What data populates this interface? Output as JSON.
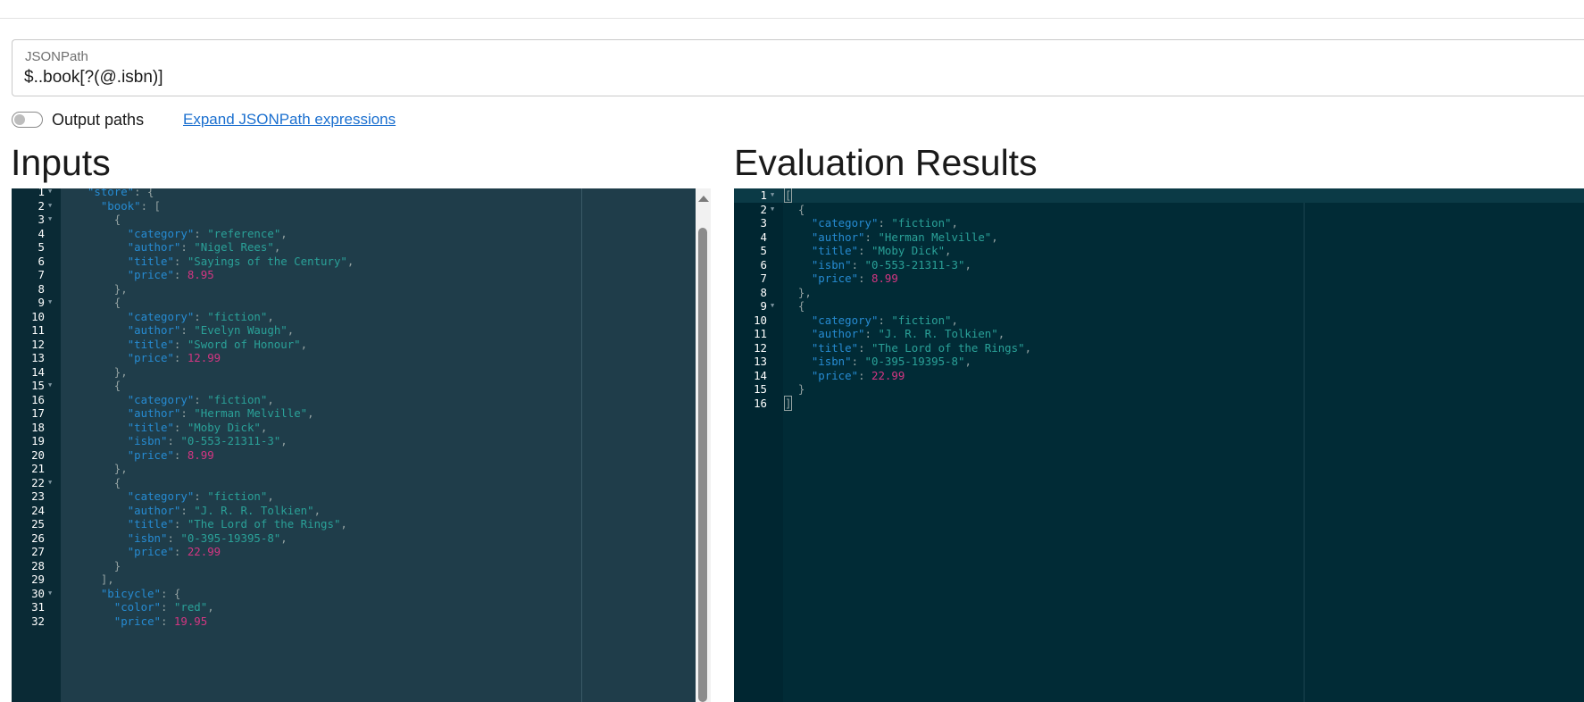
{
  "query": {
    "label": "JSONPath",
    "value": "$..book[?(@.isbn)]"
  },
  "options": {
    "output_paths_label": "Output paths",
    "output_paths_on": false,
    "expand_link": "Expand JSONPath expressions"
  },
  "inputs_heading": "Inputs",
  "results_heading": "Evaluation Results",
  "input_editor": {
    "lines": [
      {
        "n": "1",
        "fold": true,
        "tokens": [
          [
            "p",
            "  "
          ],
          [
            "k",
            "\"store\""
          ],
          [
            "p",
            ": {"
          ]
        ]
      },
      {
        "n": "2",
        "fold": true,
        "tokens": [
          [
            "p",
            "    "
          ],
          [
            "k",
            "\"book\""
          ],
          [
            "p",
            ": ["
          ]
        ]
      },
      {
        "n": "3",
        "fold": true,
        "tokens": [
          [
            "p",
            "      {"
          ]
        ]
      },
      {
        "n": "4",
        "tokens": [
          [
            "p",
            "        "
          ],
          [
            "k",
            "\"category\""
          ],
          [
            "p",
            ": "
          ],
          [
            "s",
            "\"reference\""
          ],
          [
            "p",
            ","
          ]
        ]
      },
      {
        "n": "5",
        "tokens": [
          [
            "p",
            "        "
          ],
          [
            "k",
            "\"author\""
          ],
          [
            "p",
            ": "
          ],
          [
            "s",
            "\"Nigel Rees\""
          ],
          [
            "p",
            ","
          ]
        ]
      },
      {
        "n": "6",
        "tokens": [
          [
            "p",
            "        "
          ],
          [
            "k",
            "\"title\""
          ],
          [
            "p",
            ": "
          ],
          [
            "s",
            "\"Sayings of the Century\""
          ],
          [
            "p",
            ","
          ]
        ]
      },
      {
        "n": "7",
        "tokens": [
          [
            "p",
            "        "
          ],
          [
            "k",
            "\"price\""
          ],
          [
            "p",
            ": "
          ],
          [
            "n",
            "8.95"
          ]
        ]
      },
      {
        "n": "8",
        "tokens": [
          [
            "p",
            "      },"
          ]
        ]
      },
      {
        "n": "9",
        "fold": true,
        "tokens": [
          [
            "p",
            "      {"
          ]
        ]
      },
      {
        "n": "10",
        "tokens": [
          [
            "p",
            "        "
          ],
          [
            "k",
            "\"category\""
          ],
          [
            "p",
            ": "
          ],
          [
            "s",
            "\"fiction\""
          ],
          [
            "p",
            ","
          ]
        ]
      },
      {
        "n": "11",
        "tokens": [
          [
            "p",
            "        "
          ],
          [
            "k",
            "\"author\""
          ],
          [
            "p",
            ": "
          ],
          [
            "s",
            "\"Evelyn Waugh\""
          ],
          [
            "p",
            ","
          ]
        ]
      },
      {
        "n": "12",
        "tokens": [
          [
            "p",
            "        "
          ],
          [
            "k",
            "\"title\""
          ],
          [
            "p",
            ": "
          ],
          [
            "s",
            "\"Sword of Honour\""
          ],
          [
            "p",
            ","
          ]
        ]
      },
      {
        "n": "13",
        "tokens": [
          [
            "p",
            "        "
          ],
          [
            "k",
            "\"price\""
          ],
          [
            "p",
            ": "
          ],
          [
            "n",
            "12.99"
          ]
        ]
      },
      {
        "n": "14",
        "tokens": [
          [
            "p",
            "      },"
          ]
        ]
      },
      {
        "n": "15",
        "fold": true,
        "tokens": [
          [
            "p",
            "      {"
          ]
        ]
      },
      {
        "n": "16",
        "tokens": [
          [
            "p",
            "        "
          ],
          [
            "k",
            "\"category\""
          ],
          [
            "p",
            ": "
          ],
          [
            "s",
            "\"fiction\""
          ],
          [
            "p",
            ","
          ]
        ]
      },
      {
        "n": "17",
        "tokens": [
          [
            "p",
            "        "
          ],
          [
            "k",
            "\"author\""
          ],
          [
            "p",
            ": "
          ],
          [
            "s",
            "\"Herman Melville\""
          ],
          [
            "p",
            ","
          ]
        ]
      },
      {
        "n": "18",
        "tokens": [
          [
            "p",
            "        "
          ],
          [
            "k",
            "\"title\""
          ],
          [
            "p",
            ": "
          ],
          [
            "s",
            "\"Moby Dick\""
          ],
          [
            "p",
            ","
          ]
        ]
      },
      {
        "n": "19",
        "tokens": [
          [
            "p",
            "        "
          ],
          [
            "k",
            "\"isbn\""
          ],
          [
            "p",
            ": "
          ],
          [
            "s",
            "\"0-553-21311-3\""
          ],
          [
            "p",
            ","
          ]
        ]
      },
      {
        "n": "20",
        "tokens": [
          [
            "p",
            "        "
          ],
          [
            "k",
            "\"price\""
          ],
          [
            "p",
            ": "
          ],
          [
            "n",
            "8.99"
          ]
        ]
      },
      {
        "n": "21",
        "tokens": [
          [
            "p",
            "      },"
          ]
        ]
      },
      {
        "n": "22",
        "fold": true,
        "tokens": [
          [
            "p",
            "      {"
          ]
        ]
      },
      {
        "n": "23",
        "tokens": [
          [
            "p",
            "        "
          ],
          [
            "k",
            "\"category\""
          ],
          [
            "p",
            ": "
          ],
          [
            "s",
            "\"fiction\""
          ],
          [
            "p",
            ","
          ]
        ]
      },
      {
        "n": "24",
        "tokens": [
          [
            "p",
            "        "
          ],
          [
            "k",
            "\"author\""
          ],
          [
            "p",
            ": "
          ],
          [
            "s",
            "\"J. R. R. Tolkien\""
          ],
          [
            "p",
            ","
          ]
        ]
      },
      {
        "n": "25",
        "tokens": [
          [
            "p",
            "        "
          ],
          [
            "k",
            "\"title\""
          ],
          [
            "p",
            ": "
          ],
          [
            "s",
            "\"The Lord of the Rings\""
          ],
          [
            "p",
            ","
          ]
        ]
      },
      {
        "n": "26",
        "tokens": [
          [
            "p",
            "        "
          ],
          [
            "k",
            "\"isbn\""
          ],
          [
            "p",
            ": "
          ],
          [
            "s",
            "\"0-395-19395-8\""
          ],
          [
            "p",
            ","
          ]
        ]
      },
      {
        "n": "27",
        "tokens": [
          [
            "p",
            "        "
          ],
          [
            "k",
            "\"price\""
          ],
          [
            "p",
            ": "
          ],
          [
            "n",
            "22.99"
          ]
        ]
      },
      {
        "n": "28",
        "tokens": [
          [
            "p",
            "      }"
          ]
        ]
      },
      {
        "n": "29",
        "tokens": [
          [
            "p",
            "    ],"
          ]
        ]
      },
      {
        "n": "30",
        "fold": true,
        "tokens": [
          [
            "p",
            "    "
          ],
          [
            "k",
            "\"bicycle\""
          ],
          [
            "p",
            ": {"
          ]
        ]
      },
      {
        "n": "31",
        "tokens": [
          [
            "p",
            "      "
          ],
          [
            "k",
            "\"color\""
          ],
          [
            "p",
            ": "
          ],
          [
            "s",
            "\"red\""
          ],
          [
            "p",
            ","
          ]
        ]
      },
      {
        "n": "32",
        "tokens": [
          [
            "p",
            "      "
          ],
          [
            "k",
            "\"price\""
          ],
          [
            "p",
            ": "
          ],
          [
            "n",
            "19.95"
          ]
        ]
      }
    ]
  },
  "result_editor": {
    "lines": [
      {
        "n": "1",
        "fold": true,
        "active": true,
        "tokens": [
          [
            "c",
            "["
          ]
        ]
      },
      {
        "n": "2",
        "fold": true,
        "tokens": [
          [
            "p",
            "  {"
          ]
        ]
      },
      {
        "n": "3",
        "tokens": [
          [
            "p",
            "    "
          ],
          [
            "k",
            "\"category\""
          ],
          [
            "p",
            ": "
          ],
          [
            "s",
            "\"fiction\""
          ],
          [
            "p",
            ","
          ]
        ]
      },
      {
        "n": "4",
        "tokens": [
          [
            "p",
            "    "
          ],
          [
            "k",
            "\"author\""
          ],
          [
            "p",
            ": "
          ],
          [
            "s",
            "\"Herman Melville\""
          ],
          [
            "p",
            ","
          ]
        ]
      },
      {
        "n": "5",
        "tokens": [
          [
            "p",
            "    "
          ],
          [
            "k",
            "\"title\""
          ],
          [
            "p",
            ": "
          ],
          [
            "s",
            "\"Moby Dick\""
          ],
          [
            "p",
            ","
          ]
        ]
      },
      {
        "n": "6",
        "tokens": [
          [
            "p",
            "    "
          ],
          [
            "k",
            "\"isbn\""
          ],
          [
            "p",
            ": "
          ],
          [
            "s",
            "\"0-553-21311-3\""
          ],
          [
            "p",
            ","
          ]
        ]
      },
      {
        "n": "7",
        "tokens": [
          [
            "p",
            "    "
          ],
          [
            "k",
            "\"price\""
          ],
          [
            "p",
            ": "
          ],
          [
            "n",
            "8.99"
          ]
        ]
      },
      {
        "n": "8",
        "tokens": [
          [
            "p",
            "  },"
          ]
        ]
      },
      {
        "n": "9",
        "fold": true,
        "tokens": [
          [
            "p",
            "  {"
          ]
        ]
      },
      {
        "n": "10",
        "tokens": [
          [
            "p",
            "    "
          ],
          [
            "k",
            "\"category\""
          ],
          [
            "p",
            ": "
          ],
          [
            "s",
            "\"fiction\""
          ],
          [
            "p",
            ","
          ]
        ]
      },
      {
        "n": "11",
        "tokens": [
          [
            "p",
            "    "
          ],
          [
            "k",
            "\"author\""
          ],
          [
            "p",
            ": "
          ],
          [
            "s",
            "\"J. R. R. Tolkien\""
          ],
          [
            "p",
            ","
          ]
        ]
      },
      {
        "n": "12",
        "tokens": [
          [
            "p",
            "    "
          ],
          [
            "k",
            "\"title\""
          ],
          [
            "p",
            ": "
          ],
          [
            "s",
            "\"The Lord of the Rings\""
          ],
          [
            "p",
            ","
          ]
        ]
      },
      {
        "n": "13",
        "tokens": [
          [
            "p",
            "    "
          ],
          [
            "k",
            "\"isbn\""
          ],
          [
            "p",
            ": "
          ],
          [
            "s",
            "\"0-395-19395-8\""
          ],
          [
            "p",
            ","
          ]
        ]
      },
      {
        "n": "14",
        "tokens": [
          [
            "p",
            "    "
          ],
          [
            "k",
            "\"price\""
          ],
          [
            "p",
            ": "
          ],
          [
            "n",
            "22.99"
          ]
        ]
      },
      {
        "n": "15",
        "tokens": [
          [
            "p",
            "  }"
          ]
        ]
      },
      {
        "n": "16",
        "tokens": [
          [
            "c",
            "]"
          ]
        ]
      }
    ]
  },
  "colors": {
    "key": "#268bd2",
    "string": "#2aa198",
    "number": "#d33682",
    "input_bg": "#1f3d4a",
    "result_bg": "#012b36",
    "link": "#1a6fcf"
  },
  "icons": {
    "fold": "triangle-down",
    "scroll_up": "arrow-up"
  }
}
